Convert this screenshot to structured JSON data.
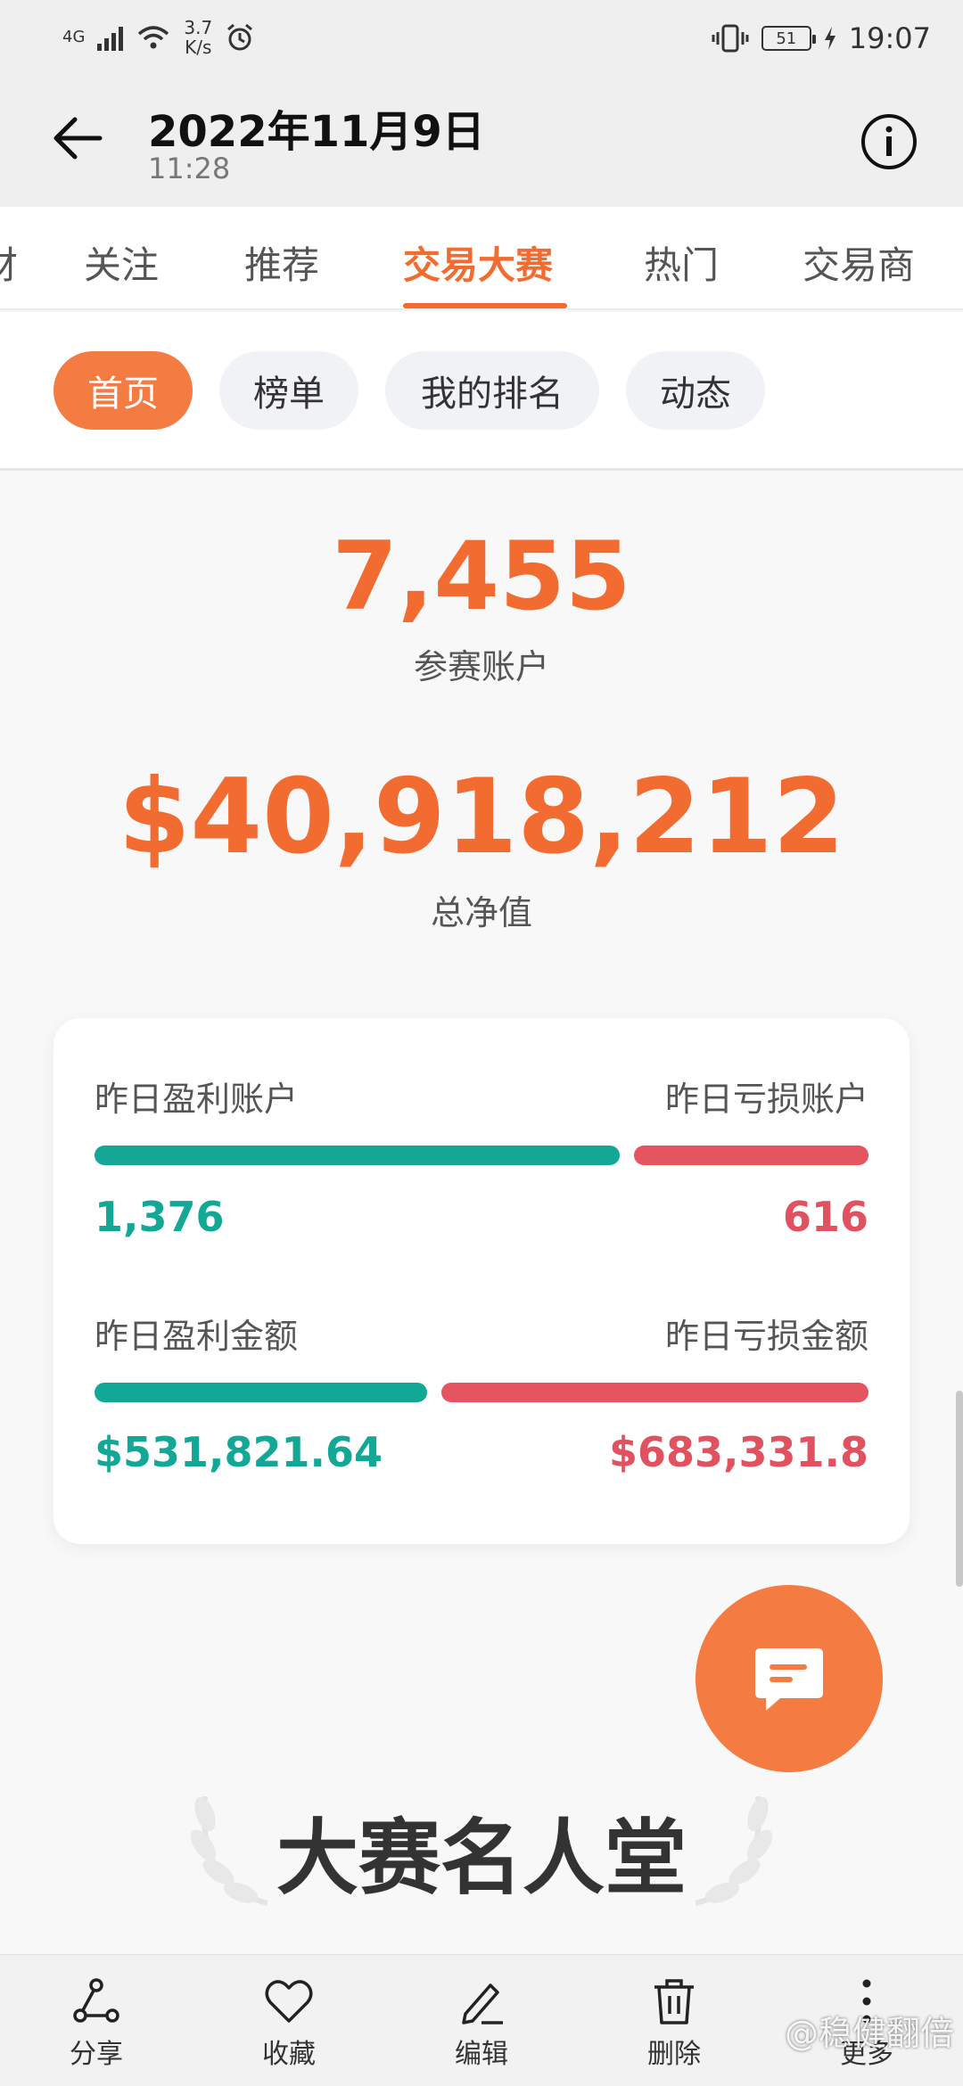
{
  "status_bar": {
    "network": "4G",
    "speed_value": "3.7",
    "speed_unit": "K/s",
    "battery": "51",
    "time": "19:07"
  },
  "header": {
    "title": "2022年11月9日",
    "subtitle": "11:28"
  },
  "tabs": [
    {
      "label": "财"
    },
    {
      "label": "关注"
    },
    {
      "label": "推荐"
    },
    {
      "label": "交易大赛",
      "active": true
    },
    {
      "label": "热门"
    },
    {
      "label": "交易商"
    }
  ],
  "subnav": [
    {
      "label": "首页",
      "active": true
    },
    {
      "label": "榜单"
    },
    {
      "label": "我的排名"
    },
    {
      "label": "动态"
    }
  ],
  "stats": {
    "accounts_value": "7,455",
    "accounts_label": "参赛账户",
    "equity_value": "$40,918,212",
    "equity_label": "总净值"
  },
  "summary_card": {
    "profit_accounts_label": "昨日盈利账户",
    "loss_accounts_label": "昨日亏损账户",
    "profit_accounts_value": "1,376",
    "loss_accounts_value": "616",
    "profit_accounts_share": 0.691,
    "profit_amount_label": "昨日盈利金额",
    "loss_amount_label": "昨日亏损金额",
    "profit_amount_value": "$531,821.64",
    "loss_amount_value": "$683,331.8",
    "profit_amount_share": 0.438
  },
  "hall_of_fame": {
    "title": "大赛名人堂"
  },
  "bottom_bar": {
    "share": "分享",
    "favorite": "收藏",
    "edit": "编辑",
    "delete": "删除",
    "more": "更多"
  },
  "watermark": "@稳健翻倍",
  "colors": {
    "accent": "#f26c32",
    "profit": "#13a796",
    "loss": "#e0525f"
  }
}
